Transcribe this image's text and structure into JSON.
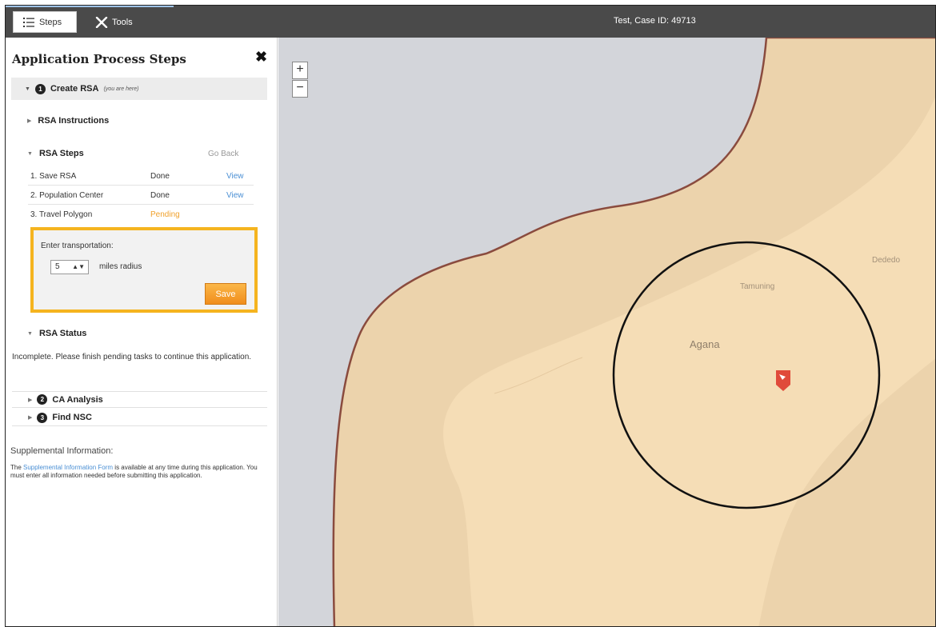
{
  "topbar": {
    "steps_tab": "Steps",
    "steps_icon": "list-numbered-icon",
    "tools_tab": "Tools",
    "tools_icon": "tools-icon",
    "case_title": "Test, Case ID: 49713"
  },
  "panel": {
    "title": "Application Process Steps",
    "close_label": "✖",
    "step1": {
      "number": "1",
      "name": "Create RSA",
      "here_note": "(you are here)"
    },
    "instructions_label": "RSA Instructions",
    "rsa_steps_label": "RSA Steps",
    "go_back_label": "Go Back",
    "steps": [
      {
        "name": "1. Save RSA",
        "status": "Done",
        "action": "View"
      },
      {
        "name": "2. Population Center",
        "status": "Done",
        "action": "View"
      },
      {
        "name": "3. Travel Polygon",
        "status": "Pending",
        "action": ""
      }
    ],
    "transport": {
      "label": "Enter transportation:",
      "value": "5",
      "unit_label": "miles radius",
      "save_label": "Save"
    },
    "rsa_status_label": "RSA Status",
    "rsa_status_text": "Incomplete. Please finish pending tasks to continue this application.",
    "step2": {
      "number": "2",
      "name": "CA Analysis"
    },
    "step3": {
      "number": "3",
      "name": "Find NSC"
    },
    "supplemental": {
      "title": "Supplemental Information:",
      "text_before": "The ",
      "link": "Supplemental Information Form",
      "text_after": " is available at any time during this application. You must enter all information needed before submitting this application."
    }
  },
  "map": {
    "zoom_in": "+",
    "zoom_out": "−",
    "cities": {
      "dededo": "Dededo",
      "tamuning": "Tamuning",
      "agana": "Agana"
    },
    "colors": {
      "water": "#d3d5da",
      "land": "#f5ddb6",
      "buffer": "#ecd3ac",
      "border": "#8a4b3e",
      "marker": "#e04a3a",
      "accent": "#f5b41f"
    }
  }
}
